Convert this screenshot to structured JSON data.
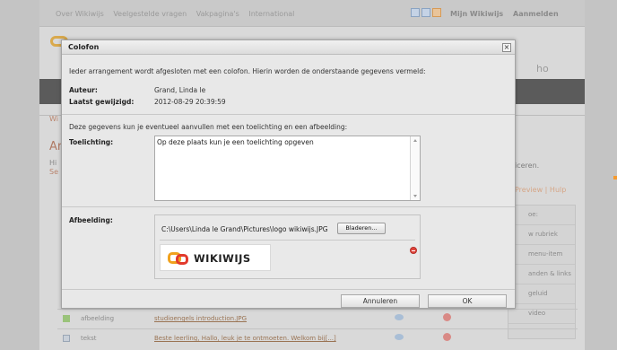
{
  "topnav": {
    "links": [
      "Over Wikiwijs",
      "Veelgestelde vragen",
      "Vakpagina's",
      "International"
    ],
    "my_wikiwijs": "Mijn Wikiwijs",
    "login": "Aanmelden"
  },
  "background": {
    "partial_ho": "ho",
    "partial_wi": "Wi",
    "partial_ar": "Ar",
    "partial_hi": "Hi",
    "partial_se": "Se",
    "partial_iceren": "iceren.",
    "preview_help": "Preview | Hulp",
    "panel_items": [
      "oe:",
      "w rubriek",
      "menu-item",
      "anden & links",
      "geluid",
      "video"
    ],
    "rows": [
      {
        "type": "afbeelding",
        "link": "studioengels introduction.JPG"
      },
      {
        "type": "tekst",
        "link": "Beste leerling, Hallo, leuk je te ontmoeten. Welkom bij[...]"
      }
    ]
  },
  "dialog": {
    "title": "Colofon",
    "intro": "Ieder arrangement wordt afgesloten met een colofon. Hierin worden de onderstaande gegevens vermeld:",
    "author_label": "Auteur:",
    "author_value": "Grand, Linda le",
    "modified_label": "Laatst gewijzigd:",
    "modified_value": "2012-08-29 20:39:59",
    "sub_intro": "Deze gegevens kun je eventueel aanvullen met een toelichting en een afbeelding:",
    "explanation_label": "Toelichting:",
    "explanation_value": "Op deze plaats kun je een toelichting opgeven",
    "image_label": "Afbeelding:",
    "image_path": "C:\\Users\\Linda le Grand\\Pictures\\logo wikiwijs.JPG",
    "browse_label": "Bladeren...",
    "logo_word": "WIKIWIJS",
    "cancel_label": "Annuleren",
    "ok_label": "OK"
  }
}
